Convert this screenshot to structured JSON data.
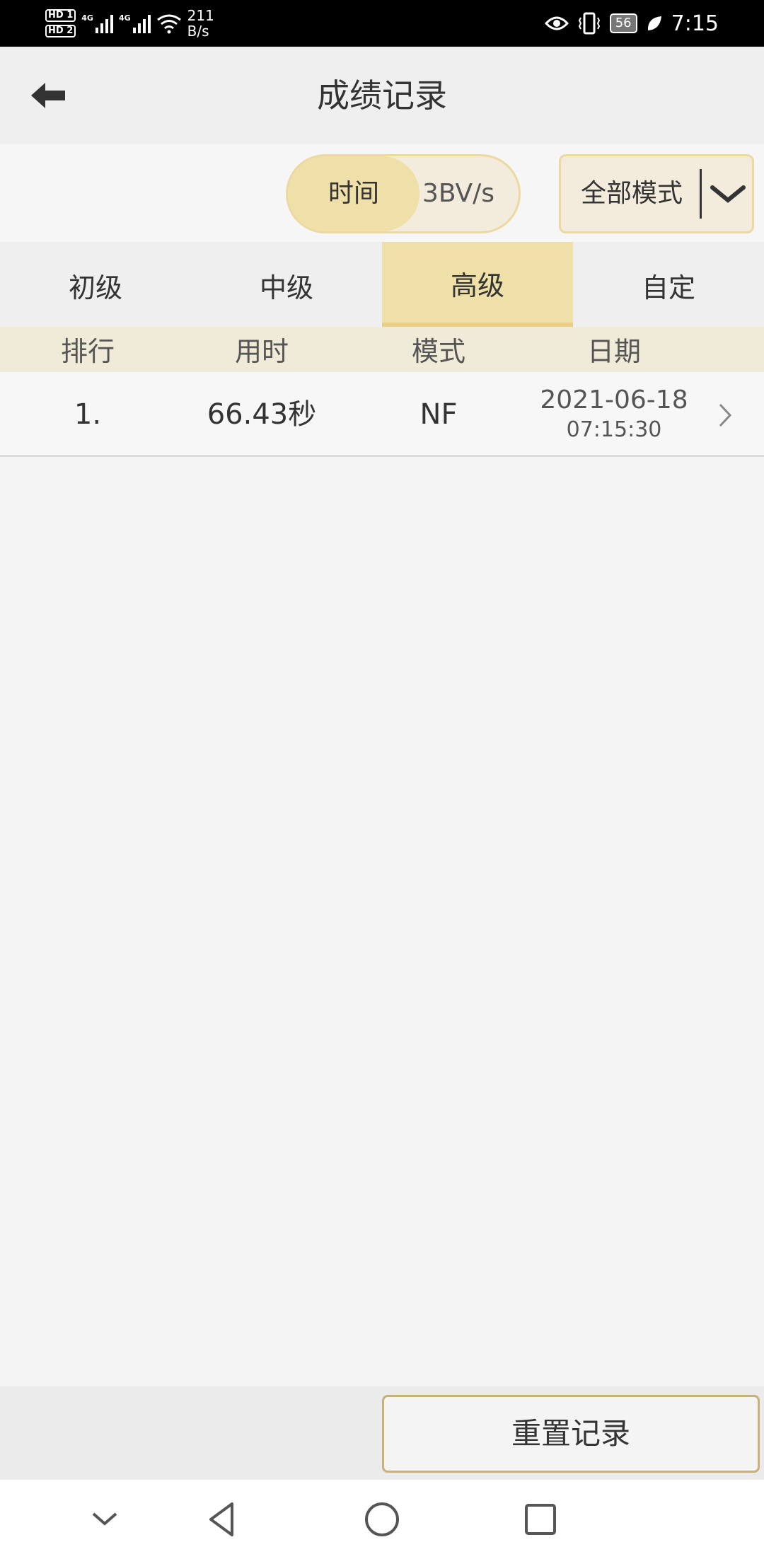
{
  "status_bar": {
    "hd1": "HD 1",
    "hd2": "HD 2",
    "sig1_label": "4G",
    "sig2_label": "4G",
    "net_speed_value": "211",
    "net_speed_unit": "B/s",
    "battery": "56",
    "time": "7:15",
    "icons": [
      "eye-icon",
      "vibrate-icon",
      "battery-icon",
      "leaf-icon"
    ]
  },
  "app_bar": {
    "title": "成绩记录",
    "back_icon": "arrow-left-icon"
  },
  "filters": {
    "sort_selected": "时间",
    "sort_other": "3BV/s",
    "mode_select": "全部模式",
    "mode_icon": "chevron-down-icon"
  },
  "tabs": [
    {
      "label": "初级",
      "active": false
    },
    {
      "label": "中级",
      "active": false
    },
    {
      "label": "高级",
      "active": true
    },
    {
      "label": "自定",
      "active": false
    }
  ],
  "table": {
    "headers": [
      "排行",
      "用时",
      "模式",
      "日期"
    ],
    "rows": [
      {
        "rank": "1.",
        "time": "66.43秒",
        "mode": "NF",
        "date": "2021-06-18",
        "clock": "07:15:30"
      }
    ]
  },
  "bottom": {
    "reset_label": "重置记录"
  },
  "nav": {
    "icons": [
      "chevron-down-icon",
      "back-triangle-icon",
      "home-circle-icon",
      "recents-square-icon"
    ]
  },
  "colors": {
    "accent": "#efdfa8",
    "accent_border": "#ecd9a2",
    "header_bg": "#f0ead8"
  }
}
